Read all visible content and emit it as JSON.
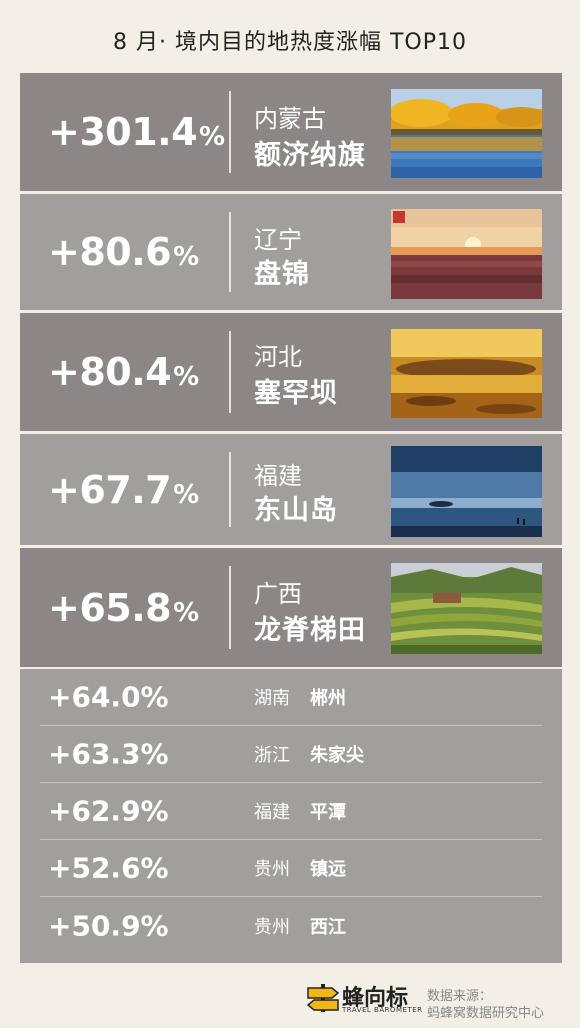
{
  "title": "8 月· 境内目的地热度涨幅 TOP10",
  "chart_data": {
    "type": "table",
    "title": "8 月· 境内目的地热度涨幅 TOP10",
    "columns": [
      "value",
      "province",
      "place"
    ],
    "rows": [
      {
        "value": "+301.4",
        "pct": "%",
        "province": "内蒙古",
        "place": "额济纳旗",
        "thumb": "autumn-lake"
      },
      {
        "value": "+80.6",
        "pct": "%",
        "province": "辽宁",
        "place": "盘锦",
        "thumb": "red-beach-sunset"
      },
      {
        "value": "+80.4",
        "pct": "%",
        "province": "河北",
        "place": "塞罕坝",
        "thumb": "golden-grassland"
      },
      {
        "value": "+67.7",
        "pct": "%",
        "province": "福建",
        "place": "东山岛",
        "thumb": "sea-island"
      },
      {
        "value": "+65.8",
        "pct": "%",
        "province": "广西",
        "place": "龙脊梯田",
        "thumb": "rice-terraces"
      },
      {
        "value": "+64.0%",
        "province": "湖南",
        "place": "郴州"
      },
      {
        "value": "+63.3%",
        "province": "浙江",
        "place": "朱家尖"
      },
      {
        "value": "+62.9%",
        "province": "福建",
        "place": "平潭"
      },
      {
        "value": "+52.6%",
        "province": "贵州",
        "place": "镇远"
      },
      {
        "value": "+50.9%",
        "province": "贵州",
        "place": "西江"
      }
    ]
  },
  "colors": {
    "background": "#f3efe6",
    "row_dark": "#8c8686",
    "row_light": "#a39e9e",
    "logo_yellow": "#f3b614"
  },
  "footer": {
    "logo_text": "蜂向标",
    "logo_sub": "TRAVEL BAROMETER",
    "source_label": "数据来源：",
    "source_name": "蚂蜂窝数据研究中心"
  }
}
